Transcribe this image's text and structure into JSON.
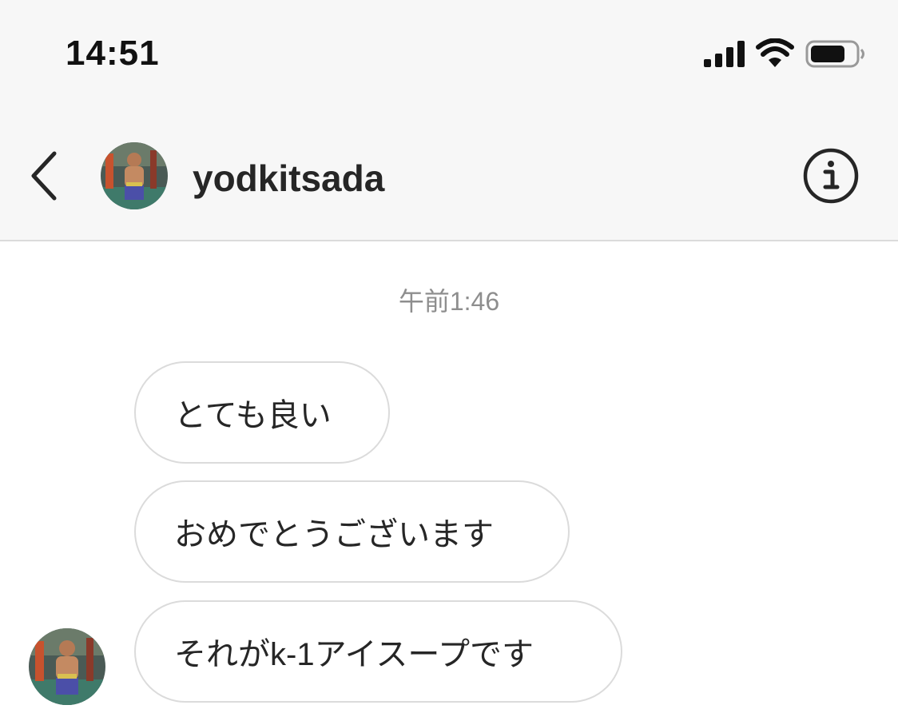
{
  "status_bar": {
    "time": "14:51",
    "icons": [
      "cellular-signal-icon",
      "wifi-icon",
      "battery-icon"
    ]
  },
  "header": {
    "back_icon": "chevron-left-icon",
    "username": "yodkitsada",
    "info_icon": "info-icon"
  },
  "conversation": {
    "timestamp": "午前1:46",
    "messages": [
      {
        "text": "とても良い"
      },
      {
        "text": "おめでとうございます"
      },
      {
        "text": "それがk-1アイスープです"
      }
    ]
  },
  "colors": {
    "header_bg": "#f7f7f7",
    "divider": "#dbdbdb",
    "bubble_border": "#dbdbdb",
    "timestamp_text": "#8e8e8e",
    "text": "#262626"
  }
}
